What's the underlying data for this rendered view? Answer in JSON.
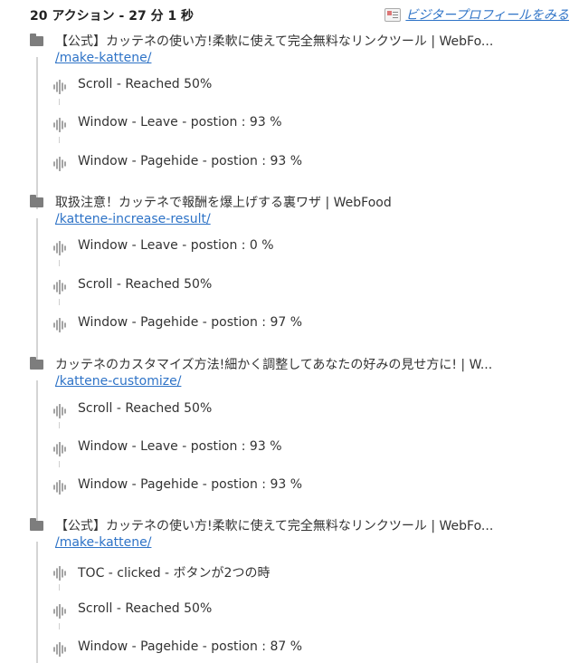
{
  "header": {
    "summary": "20 アクション - 27 分 1 秒",
    "visitor_profile_link": "ビジタープロフィールをみる"
  },
  "icons": {
    "page": "folder-icon",
    "event": "soundwave-icon",
    "profile": "profile-card-icon"
  },
  "colors": {
    "link": "#2e73c7",
    "icon": "#7d7d7d",
    "line": "#d4d4d4"
  },
  "pages": [
    {
      "title": "【公式】カッテネの使い方!柔軟に使えて完全無料なリンクツール | WebFo...",
      "url": "/make-kattene/",
      "events": [
        "Scroll - Reached 50%",
        "Window - Leave - postion : 93 %",
        "Window - Pagehide - postion : 93 %"
      ]
    },
    {
      "title": "取扱注意！カッテネで報酬を爆上げする裏ワザ | WebFood",
      "url": "/kattene-increase-result/",
      "events": [
        "Window - Leave - postion : 0 %",
        "Scroll - Reached 50%",
        "Window - Pagehide - postion : 97 %"
      ]
    },
    {
      "title": "カッテネのカスタマイズ方法!細かく調整してあなたの好みの見せ方に! | W...",
      "url": "/kattene-customize/",
      "events": [
        "Scroll - Reached 50%",
        "Window - Leave - postion : 93 %",
        "Window - Pagehide - postion : 93 %"
      ]
    },
    {
      "title": "【公式】カッテネの使い方!柔軟に使えて完全無料なリンクツール | WebFo...",
      "url": "/make-kattene/",
      "events": [
        "TOC - clicked - ボタンが2つの時",
        "Scroll - Reached 50%",
        "Window - Pagehide - postion : 87 %"
      ]
    }
  ]
}
